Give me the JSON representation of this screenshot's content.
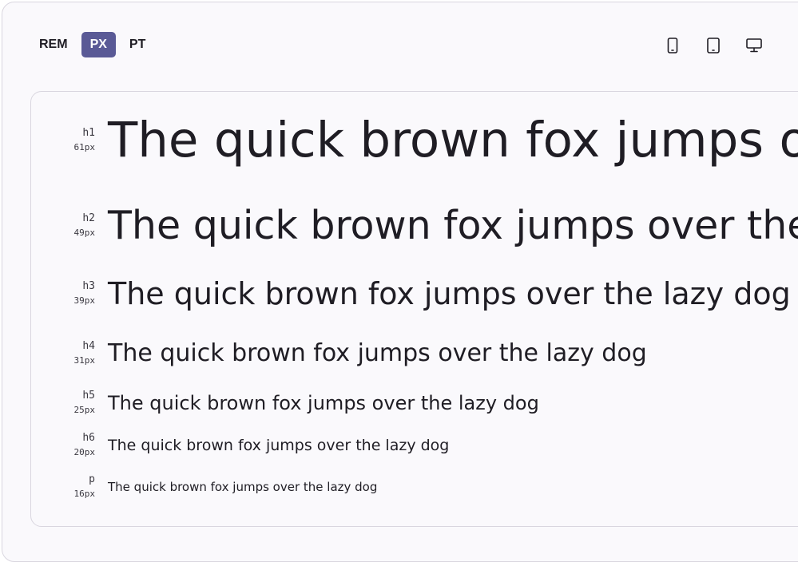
{
  "units": {
    "tabs": [
      {
        "label": "REM",
        "active": false
      },
      {
        "label": "PX",
        "active": true
      },
      {
        "label": "PT",
        "active": false
      }
    ]
  },
  "devices": [
    "mobile-icon",
    "tablet-icon",
    "desktop-icon"
  ],
  "preview": {
    "sample_text": "The quick brown fox jumps over the lazy dog",
    "rows": [
      {
        "tag": "h1",
        "size": "61px"
      },
      {
        "tag": "h2",
        "size": "49px"
      },
      {
        "tag": "h3",
        "size": "39px"
      },
      {
        "tag": "h4",
        "size": "31px"
      },
      {
        "tag": "h5",
        "size": "25px"
      },
      {
        "tag": "h6",
        "size": "20px"
      },
      {
        "tag": "p",
        "size": "16px"
      }
    ]
  },
  "colors": {
    "accent": "#5a5a96",
    "text": "#1f1d24",
    "border": "#d9d6df",
    "background": "#faf9fc"
  }
}
